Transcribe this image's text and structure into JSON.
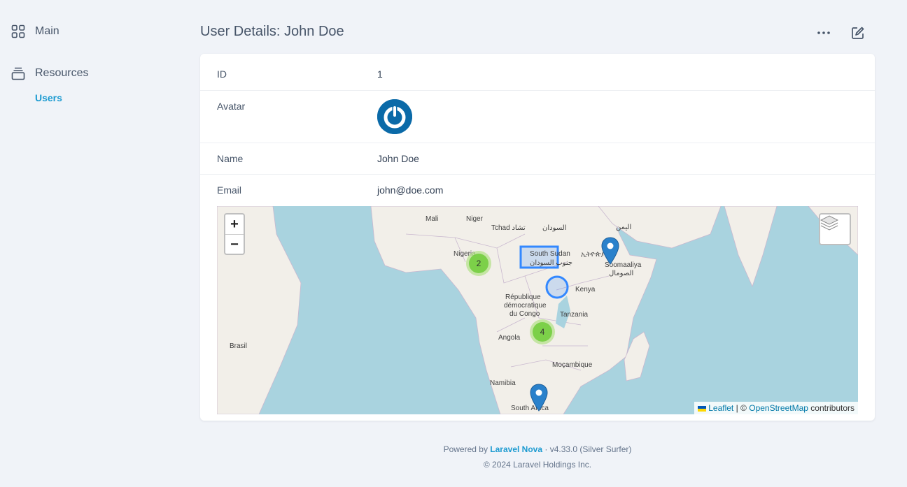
{
  "sidebar": {
    "main_label": "Main",
    "resources_label": "Resources",
    "users_label": "Users"
  },
  "header": {
    "title": "User Details: John Doe"
  },
  "fields": {
    "id_label": "ID",
    "id_value": "1",
    "avatar_label": "Avatar",
    "name_label": "Name",
    "name_value": "John Doe",
    "email_label": "Email",
    "email_value": "john@doe.com"
  },
  "map": {
    "zoom_in": "+",
    "zoom_out": "−",
    "clusters": [
      {
        "count": "2"
      },
      {
        "count": "4"
      }
    ],
    "labels": {
      "mali": "Mali",
      "niger": "Niger",
      "tchad": "Tchad تشاد",
      "sudan": "السودان",
      "yemen": "اليمن",
      "nigeria": "Nigeria",
      "south_sudan": "South Sudan",
      "south_sudan_ar": "جنوب السودان",
      "ethiopia": "ኢትዮጵያ",
      "somalia": "Soomaaliya",
      "somalia_ar": "الصومال",
      "rdc1": "République",
      "rdc2": "démocratique",
      "rdc3": "du Congo",
      "kenya": "Kenya",
      "tanzania": "Tanzania",
      "angola": "Angola",
      "brasil": "Brasil",
      "mozambique": "Moçambique",
      "namibia": "Namibia",
      "south_africa": "South Africa"
    },
    "attribution": {
      "leaflet": "Leaflet",
      "sep": "| ©",
      "osm": "OpenStreetMap",
      "contributors": "contributors"
    }
  },
  "footer": {
    "powered_by": "Powered by",
    "nova_link": "Laravel Nova",
    "version": "· v4.33.0 (Silver Surfer)",
    "copyright": "© 2024 Laravel Holdings Inc."
  },
  "colors": {
    "accent": "#1d9bd1",
    "marker": "#2a81cb",
    "water": "#a9d3df",
    "land": "#f2efe9"
  }
}
